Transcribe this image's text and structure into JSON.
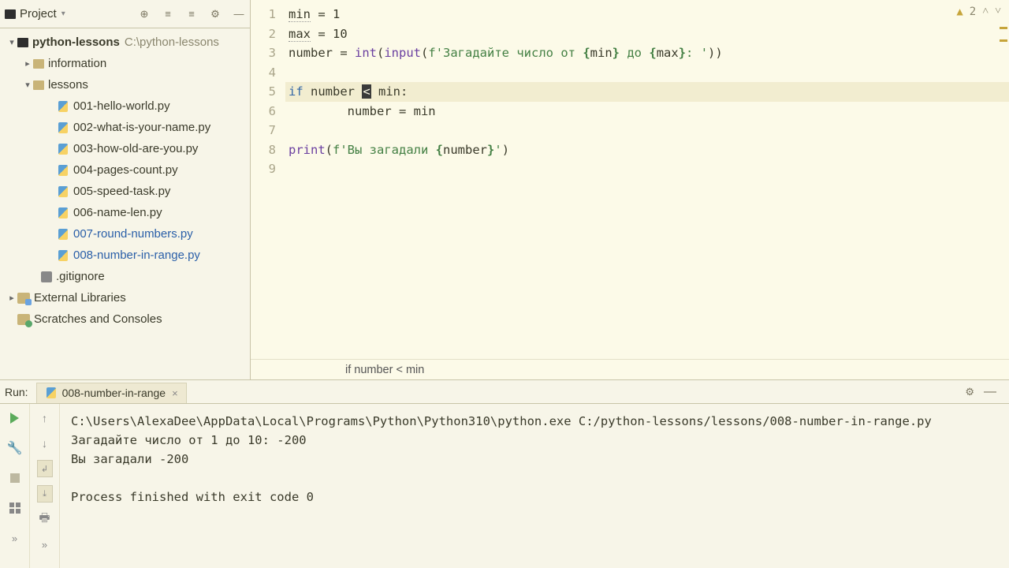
{
  "sidebar": {
    "title": "Project",
    "root": {
      "name": "python-lessons",
      "path": "C:\\python-lessons"
    },
    "folders": {
      "information": "information",
      "lessons": "lessons"
    },
    "files": [
      "001-hello-world.py",
      "002-what-is-your-name.py",
      "003-how-old-are-you.py",
      "004-pages-count.py",
      "005-speed-task.py",
      "006-name-len.py",
      "007-round-numbers.py",
      "008-number-in-range.py"
    ],
    "gitignore": ".gitignore",
    "external": "External Libraries",
    "scratches": "Scratches and Consoles"
  },
  "editor": {
    "warnings": "2",
    "lines": [
      "1",
      "2",
      "3",
      "4",
      "5",
      "6",
      "7",
      "8",
      "9"
    ],
    "code": {
      "l1_var": "min",
      "l1_rest": " = 1",
      "l2_var": "max",
      "l2_rest": " = 10",
      "l3_a": "number = ",
      "l3_int": "int",
      "l3_b": "(",
      "l3_input": "input",
      "l3_c": "(",
      "l3_str1": "f'Загадайте число от ",
      "l3_br1": "{",
      "l3_min": "min",
      "l3_br2": "}",
      "l3_str2": " до ",
      "l3_br3": "{",
      "l3_max": "max",
      "l3_br4": "}",
      "l3_str3": ": '",
      "l3_end": "))",
      "l5_if": "if",
      "l5_a": " number ",
      "l5_op": "<",
      "l5_b": " min:",
      "l6": "        number = min",
      "l8_print": "print",
      "l8_a": "(",
      "l8_str1": "f'Вы загадали ",
      "l8_br1": "{",
      "l8_num": "number",
      "l8_br2": "}",
      "l8_str2": "'",
      "l8_end": ")"
    },
    "breadcrumb": "if number < min"
  },
  "run": {
    "title": "Run:",
    "tab": "008-number-in-range",
    "console": {
      "path": "C:\\Users\\AlexaDee\\AppData\\Local\\Programs\\Python\\Python310\\python.exe C:/python-lessons/lessons/008-number-in-range.py",
      "line2": "Загадайте число от 1 до 10: -200",
      "line3": "Вы загадали -200",
      "exit": "Process finished with exit code 0"
    }
  }
}
